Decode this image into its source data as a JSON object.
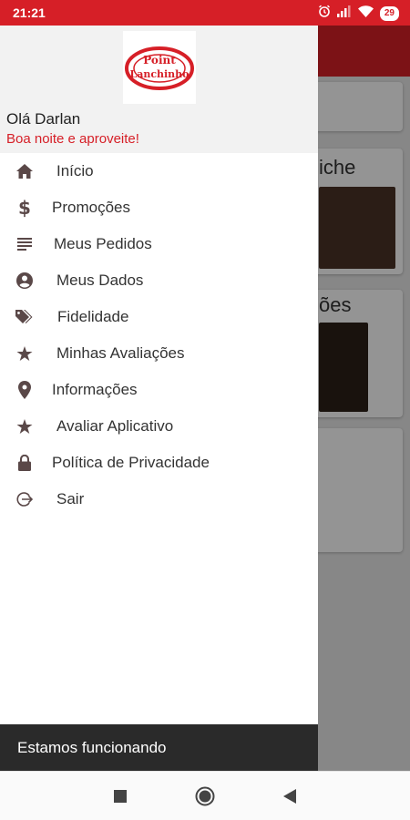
{
  "status_bar": {
    "time": "21:21",
    "battery": "29",
    "icons": [
      "alarm-icon",
      "signal-icon",
      "wifi-icon",
      "battery-icon"
    ]
  },
  "background": {
    "card_titles": [
      "iche",
      "ões"
    ]
  },
  "drawer": {
    "logo_text": "Point Lanchinho",
    "greeting": "Olá Darlan",
    "subgreeting": "Boa noite e aproveite!",
    "menu": [
      {
        "label": "Início",
        "icon": "home-icon"
      },
      {
        "label": "Promoções",
        "icon": "dollar-icon"
      },
      {
        "label": "Meus Pedidos",
        "icon": "list-icon"
      },
      {
        "label": "Meus Dados",
        "icon": "account-icon"
      },
      {
        "label": "Fidelidade",
        "icon": "tag-icon"
      },
      {
        "label": "Minhas Avaliações",
        "icon": "star-icon"
      },
      {
        "label": "Informações",
        "icon": "location-pin-icon"
      },
      {
        "label": "Avaliar Aplicativo",
        "icon": "star-icon"
      },
      {
        "label": "Política de Privacidade",
        "icon": "lock-icon"
      },
      {
        "label": "Sair",
        "icon": "logout-icon"
      }
    ],
    "footer": "Estamos funcionando"
  },
  "colors": {
    "brand": "#d61f27",
    "icon": "#5a4848",
    "footer_bg": "#2a2a2a"
  }
}
